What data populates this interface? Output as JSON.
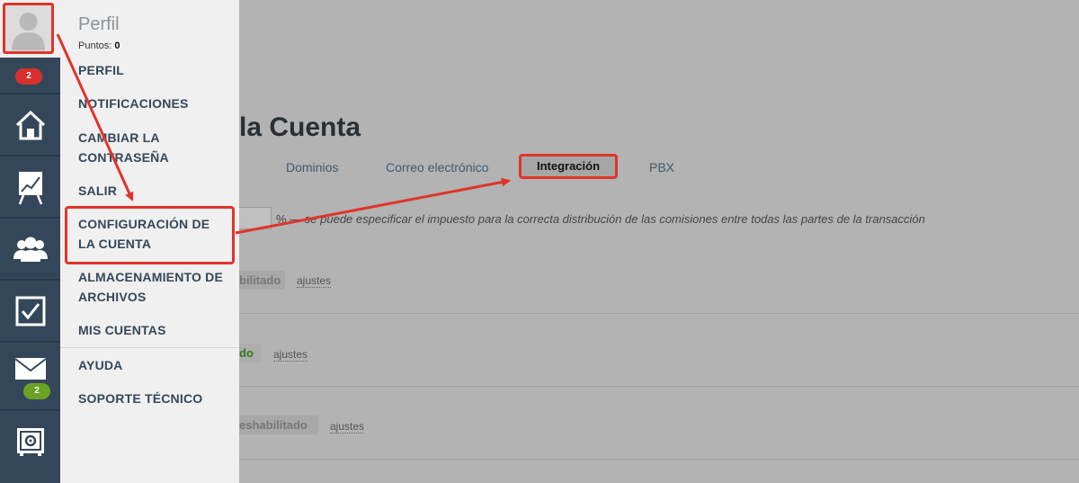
{
  "sidebar": {
    "notifications_badge": "2",
    "mail_badge": "2",
    "icons": [
      "home-icon",
      "chart-easel-icon",
      "users-group-icon",
      "checkbox-icon",
      "mail-icon",
      "safe-settings-icon"
    ]
  },
  "profile_menu": {
    "title": "Perfil",
    "points_label": "Puntos:",
    "points_value": "0",
    "items": [
      {
        "label": "PERFIL"
      },
      {
        "label": "NOTIFICACIONES"
      },
      {
        "label": "CAMBIAR LA CONTRASEÑA"
      },
      {
        "label": "SALIR"
      },
      {
        "label": "CONFIGURACIÓN DE LA CUENTA"
      },
      {
        "label": "ALMACENAMIENTO DE ARCHIVOS"
      },
      {
        "label": "MIS CUENTAS"
      },
      {
        "label": "AYUDA"
      },
      {
        "label": "SOPORTE TÉCNICO"
      }
    ]
  },
  "main": {
    "heading": "la Cuenta",
    "tabs": [
      {
        "label": "Dominios"
      },
      {
        "label": "Correo electrónico"
      },
      {
        "label": "Integración"
      },
      {
        "label": "PBX"
      }
    ],
    "tax_hint_pct": "%",
    "tax_hint": " — se puede especificar el impuesto para la correcta distribución de las comisiones entre todas las partes de la transacción",
    "rows": [
      {
        "status": "bilitado",
        "link": "ajustes"
      },
      {
        "status": "do",
        "link": "ajustes"
      },
      {
        "status": "eshabilitado",
        "link": "ajustes"
      }
    ]
  },
  "colors": {
    "annotation_red": "#e0342a",
    "sidebar_bg": "#34475a",
    "badge_red": "#d8302d",
    "badge_green": "#6aa324"
  }
}
